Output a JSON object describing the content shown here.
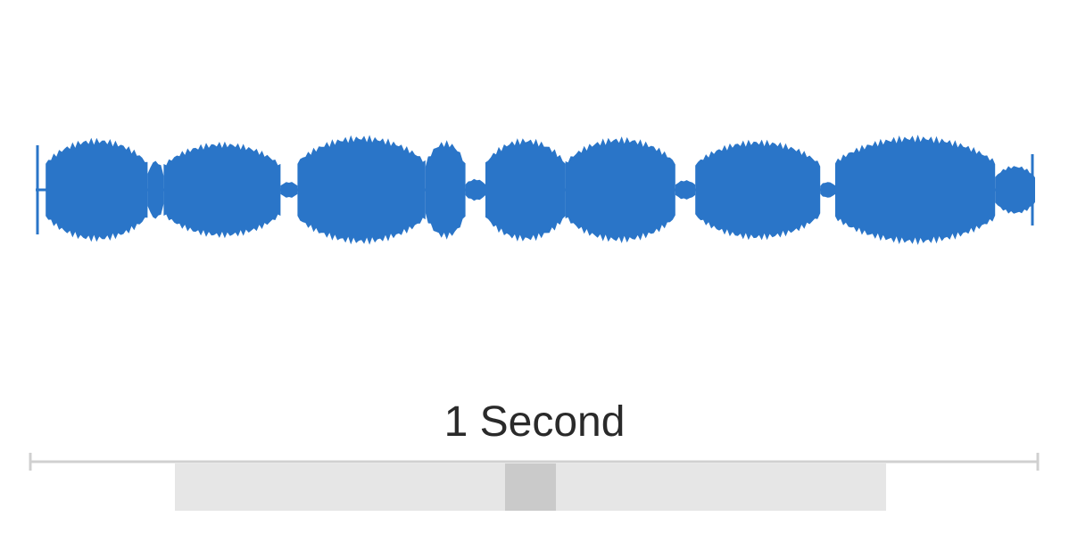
{
  "scale": {
    "label": "1 Second"
  },
  "colors": {
    "wave": "#2a75c8",
    "ruler": "#d0d0d0",
    "band": "#e6e6e6",
    "band_highlight": "#cacaca"
  },
  "waveform": {
    "segments": [
      {
        "start": 0.01,
        "end": 0.112,
        "amplitude": 0.95
      },
      {
        "start": 0.112,
        "end": 0.128,
        "amplitude": 0.55
      },
      {
        "start": 0.128,
        "end": 0.245,
        "amplitude": 0.88
      },
      {
        "start": 0.245,
        "end": 0.262,
        "amplitude": 0.15
      },
      {
        "start": 0.262,
        "end": 0.39,
        "amplitude": 1.0
      },
      {
        "start": 0.39,
        "end": 0.43,
        "amplitude": 0.9
      },
      {
        "start": 0.43,
        "end": 0.45,
        "amplitude": 0.2
      },
      {
        "start": 0.45,
        "end": 0.53,
        "amplitude": 0.95
      },
      {
        "start": 0.53,
        "end": 0.64,
        "amplitude": 0.97
      },
      {
        "start": 0.64,
        "end": 0.66,
        "amplitude": 0.18
      },
      {
        "start": 0.66,
        "end": 0.785,
        "amplitude": 0.92
      },
      {
        "start": 0.785,
        "end": 0.8,
        "amplitude": 0.15
      },
      {
        "start": 0.8,
        "end": 0.96,
        "amplitude": 1.0
      },
      {
        "start": 0.96,
        "end": 1.0,
        "amplitude": 0.45
      }
    ]
  }
}
